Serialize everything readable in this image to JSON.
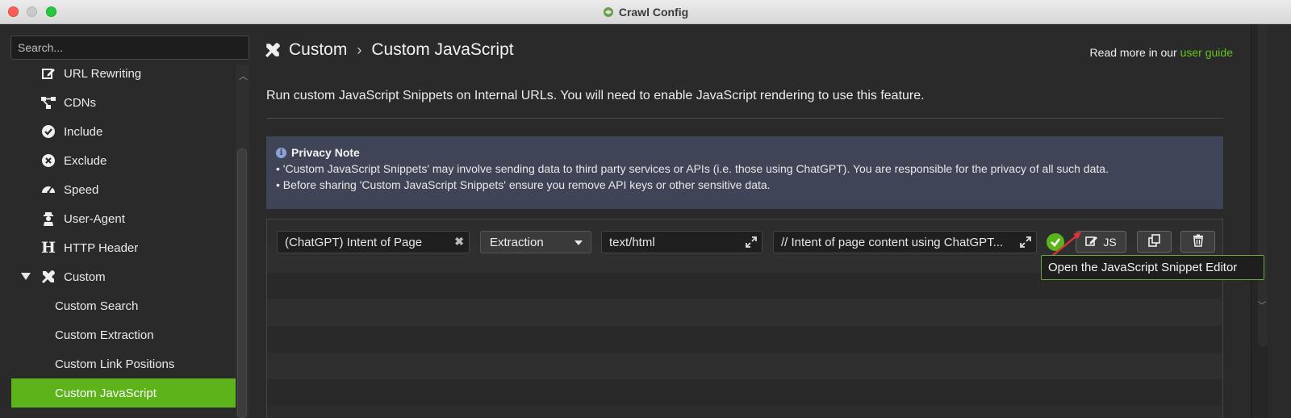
{
  "window": {
    "title": "Crawl Config"
  },
  "sidebar": {
    "search_placeholder": "Search...",
    "items": [
      {
        "label": "URL Rewriting",
        "icon": "pencil-square-icon"
      },
      {
        "label": "CDNs",
        "icon": "network-icon"
      },
      {
        "label": "Include",
        "icon": "check-circle-icon"
      },
      {
        "label": "Exclude",
        "icon": "x-circle-icon"
      },
      {
        "label": "Speed",
        "icon": "gauge-icon"
      },
      {
        "label": "User-Agent",
        "icon": "agent-icon"
      },
      {
        "label": "HTTP Header",
        "icon": "h-icon"
      },
      {
        "label": "Custom",
        "icon": "tools-icon",
        "expanded": true
      },
      {
        "label": "Custom Search"
      },
      {
        "label": "Custom Extraction"
      },
      {
        "label": "Custom Link Positions"
      },
      {
        "label": "Custom JavaScript",
        "selected": true
      }
    ]
  },
  "header": {
    "crumb_parent": "Custom",
    "separator": "›",
    "crumb_current": "Custom JavaScript",
    "guide_prefix": "Read more in our",
    "guide_link": "user guide"
  },
  "description": "Run custom JavaScript Snippets on Internal URLs. You will need to enable JavaScript rendering to use this feature.",
  "privacy_note": {
    "title": "Privacy Note",
    "lines": [
      "• 'Custom JavaScript Snippets' may involve sending data to third party services or APIs (i.e. those using ChatGPT). You are responsible for the privacy of all such data.",
      "• Before sharing 'Custom JavaScript Snippets' ensure you remove API keys or other sensitive data."
    ]
  },
  "snippet_row": {
    "name": "(ChatGPT) Intent of Page",
    "type": "Extraction",
    "content_type": "text/html",
    "code": "// Intent of page content using ChatGPT...",
    "js_button": "JS",
    "status": "valid"
  },
  "tooltip": "Open the JavaScript Snippet Editor",
  "colors": {
    "accent_green": "#5cb31a",
    "note_bg": "#3f4456",
    "link": "#66c31f"
  }
}
